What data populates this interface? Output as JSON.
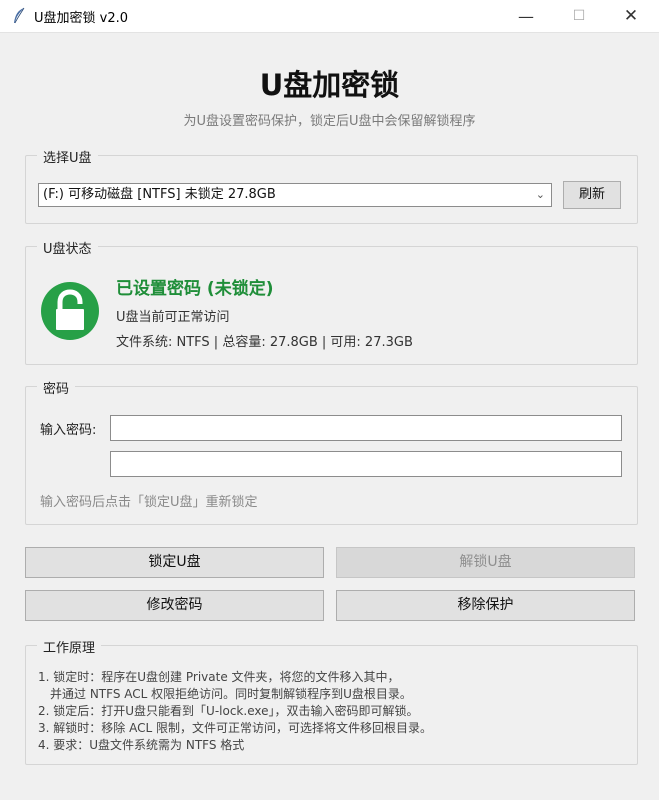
{
  "window": {
    "title": "U盘加密锁 v2.0",
    "minimize": "—",
    "maximize": "☐",
    "close": "✕"
  },
  "header": {
    "title": "U盘加密锁",
    "subtitle": "为U盘设置密码保护，锁定后U盘中会保留解锁程序"
  },
  "select_drive": {
    "label": "选择U盘",
    "selected": "(F:) 可移动磁盘  [NTFS]  未锁定  27.8GB",
    "refresh_label": "刷新"
  },
  "status": {
    "label": "U盘状态",
    "title": "已设置密码 (未锁定)",
    "description": "U盘当前可正常访问",
    "info": "文件系统: NTFS | 总容量: 27.8GB | 可用: 27.3GB",
    "color": "#1f8e39"
  },
  "password": {
    "label": "密码",
    "input_label": "输入密码:",
    "input_value": "",
    "confirm_value": "",
    "hint": "输入密码后点击「锁定U盘」重新锁定"
  },
  "actions": {
    "lock": "锁定U盘",
    "unlock": "解锁U盘",
    "change_password": "修改密码",
    "remove_protection": "移除保护"
  },
  "principle": {
    "label": "工作原理",
    "lines": [
      "1. 锁定时：程序在U盘创建 Private 文件夹，将您的文件移入其中，",
      "   并通过 NTFS ACL 权限拒绝访问。同时复制解锁程序到U盘根目录。",
      "2. 锁定后：打开U盘只能看到「U-lock.exe」，双击输入密码即可解锁。",
      "3. 解锁时：移除 ACL 限制，文件可正常访问，可选择将文件移回根目录。",
      "4. 要求：U盘文件系统需为 NTFS 格式"
    ]
  },
  "icons": {
    "app": "feather-icon",
    "status": "unlocked-padlock-icon",
    "dropdown": "chevron-down-icon"
  }
}
